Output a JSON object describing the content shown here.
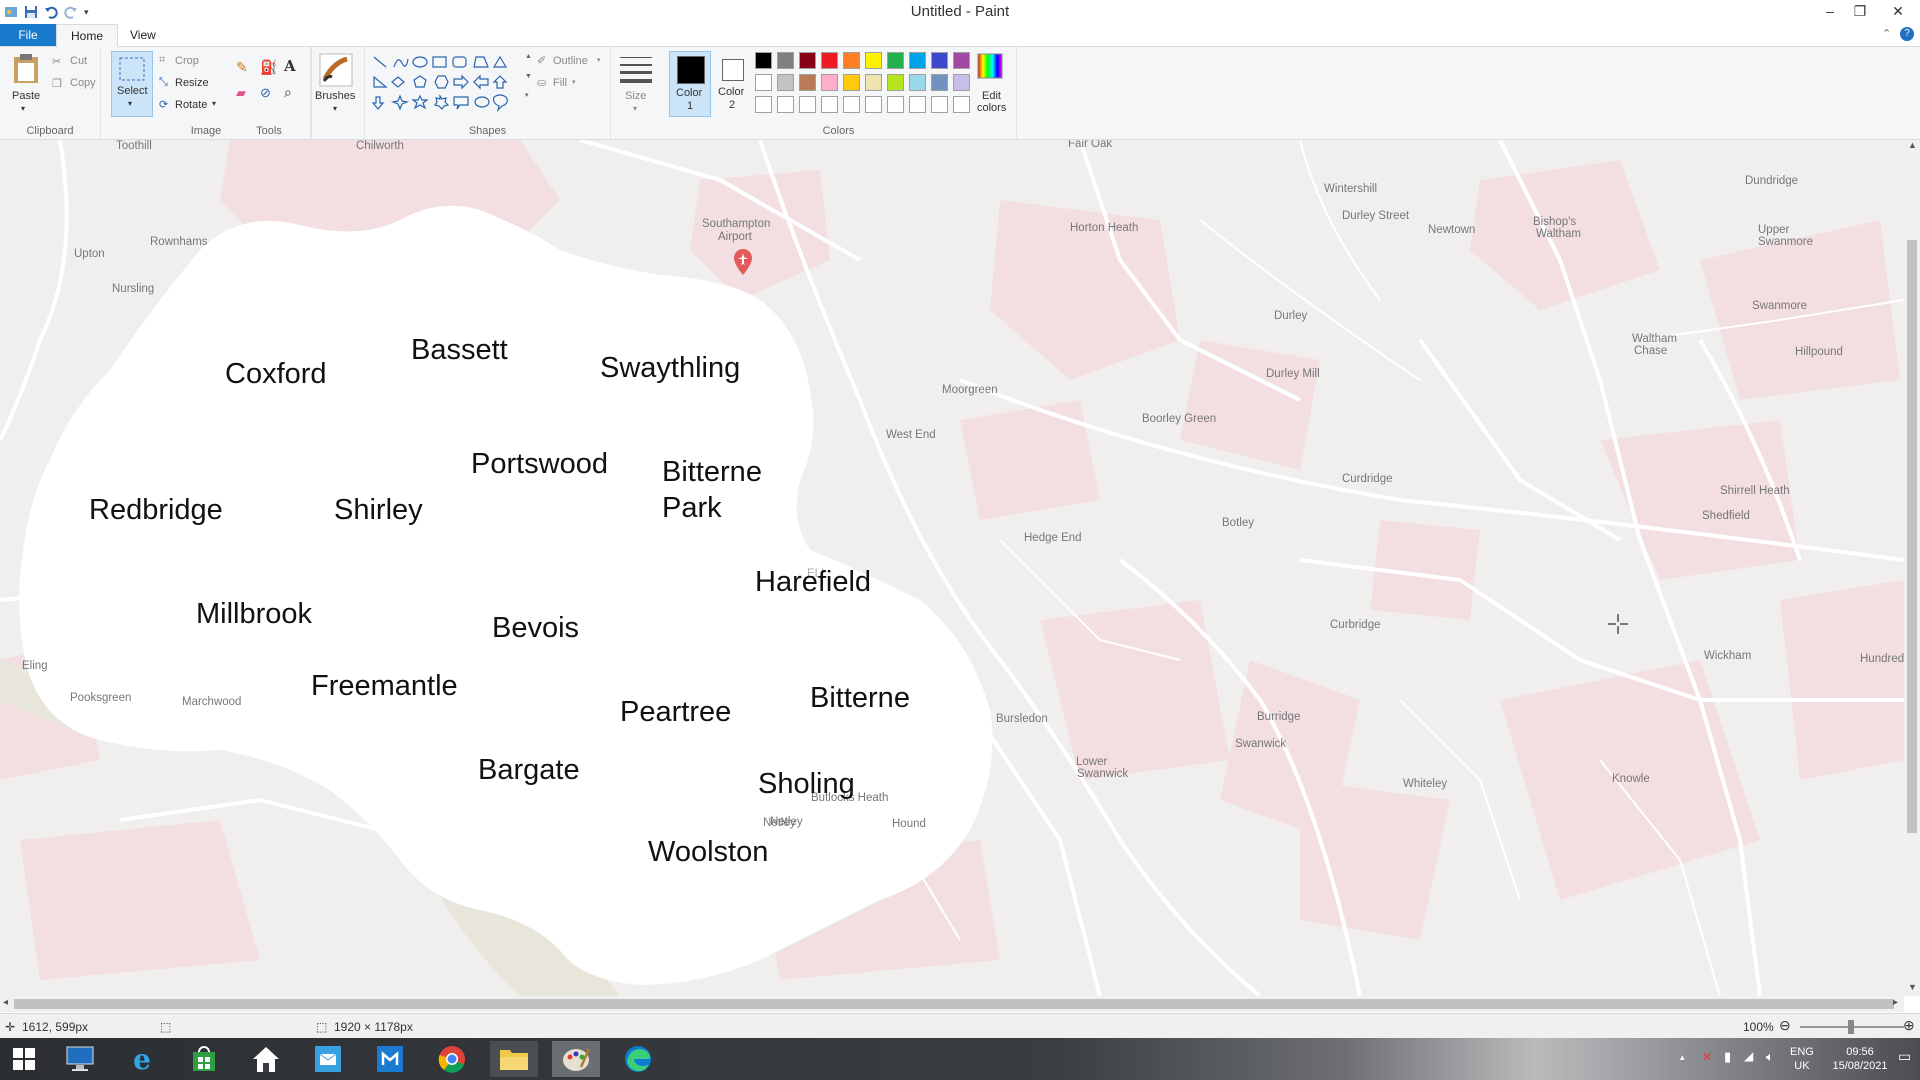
{
  "window": {
    "title": "Untitled - Paint",
    "minimize": "–",
    "maximize": "❐",
    "close": "✕"
  },
  "tabs": {
    "file": "File",
    "home": "Home",
    "view": "View"
  },
  "ribbon": {
    "clipboard": {
      "group": "Clipboard",
      "paste": "Paste",
      "cut": "Cut",
      "copy": "Copy"
    },
    "image": {
      "group": "Image",
      "select": "Select",
      "crop": "Crop",
      "resize": "Resize",
      "rotate": "Rotate"
    },
    "tools": {
      "group": "Tools"
    },
    "brushes": {
      "label": "Brushes"
    },
    "shapes": {
      "group": "Shapes",
      "outline": "Outline",
      "fill": "Fill"
    },
    "size": {
      "label": "Size"
    },
    "colors": {
      "group": "Colors",
      "color1": "Color\n1",
      "color1_l1": "Color",
      "color1_l2": "1",
      "color2_l1": "Color",
      "color2_l2": "2",
      "edit_l1": "Edit",
      "edit_l2": "colors",
      "color1_value": "#000000",
      "color2_value": "#ffffff",
      "palette_row1": [
        "#000000",
        "#7f7f7f",
        "#880015",
        "#ed1c24",
        "#ff7f27",
        "#fff200",
        "#22b14c",
        "#00a2e8",
        "#3f48cc",
        "#a349a4"
      ],
      "palette_row2": [
        "#ffffff",
        "#c3c3c3",
        "#b97a57",
        "#ffaec9",
        "#ffc90e",
        "#efe4b0",
        "#b5e61d",
        "#99d9ea",
        "#7092be",
        "#c8bfe7"
      ],
      "palette_row3": [
        "#ffffff",
        "#ffffff",
        "#ffffff",
        "#ffffff",
        "#ffffff",
        "#ffffff",
        "#ffffff",
        "#ffffff",
        "#ffffff",
        "#ffffff"
      ]
    }
  },
  "map": {
    "places": [
      "Toothill",
      "Chilworth",
      "Fair Oak",
      "Upton",
      "Rownhams",
      "Nursling",
      "Southampton",
      "Airport",
      "Wintershill",
      "Durley Street",
      "Horton Heath",
      "Newtown",
      "Bishop's",
      "Waltham",
      "Dundridge",
      "Upper",
      "Swanmore",
      "Swanmore",
      "Durley",
      "Durley Mill",
      "Hillpound",
      "Waltham",
      "Chase",
      "Moorgreen",
      "West End",
      "Boorley Green",
      "Curdridge",
      "Shirrell Heath",
      "Shedfield",
      "Botley",
      "Hedge End",
      "Eling",
      "Curbridge",
      "Wickham",
      "Hundred",
      "Pooksgreen",
      "Marchwood",
      "Netley",
      "Bursledon",
      "Burridge",
      "Swanwick",
      "Lower",
      "Swanwick",
      "Whiteley",
      "Knowle",
      "Butlocks Heath",
      "Netley",
      "Hound",
      "ELL"
    ],
    "districts": [
      "Coxford",
      "Bassett",
      "Swaythling",
      "Portswood",
      "Bitterne",
      "Park",
      "Redbridge",
      "Shirley",
      "Harefield",
      "Millbrook",
      "Bevois",
      "Freemantle",
      "Peartree",
      "Bitterne",
      "Bargate",
      "Sholing",
      "Woolston"
    ]
  },
  "status": {
    "cursor": "1612, 599px",
    "canvas_size": "1920 × 1178px",
    "zoom": "100%"
  },
  "tray": {
    "lang1": "ENG",
    "lang2": "UK",
    "time": "09:56",
    "date": "15/08/2021"
  }
}
